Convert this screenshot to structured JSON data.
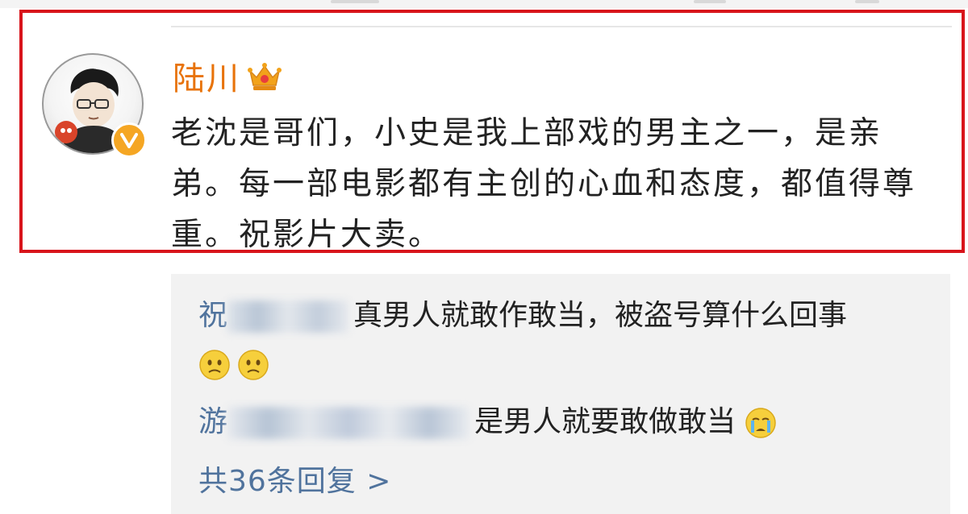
{
  "post": {
    "username": "陆川",
    "text": "老沈是哥们，小史是我上部戏的男主之一，是亲弟。每一部电影都有主创的心血和态度，都值得尊重。祝影片大卖。",
    "crown_icon": "crown-icon",
    "verified_icon": "verified-v-icon"
  },
  "replies": [
    {
      "name_prefix": "祝",
      "text": "真男人就敢作敢当，被盗号算什么回事",
      "emojis": [
        "sad-face-emoji",
        "sad-face-emoji"
      ]
    },
    {
      "name_prefix": "游",
      "text": "是男人就要敢做敢当",
      "emojis": [
        "crying-face-emoji"
      ]
    }
  ],
  "more_replies": "共36条回复 >",
  "colors": {
    "username": "#e8730a",
    "reply_name": "#50739d",
    "highlight": "#d8141b",
    "reply_bg": "#f2f2f2"
  }
}
